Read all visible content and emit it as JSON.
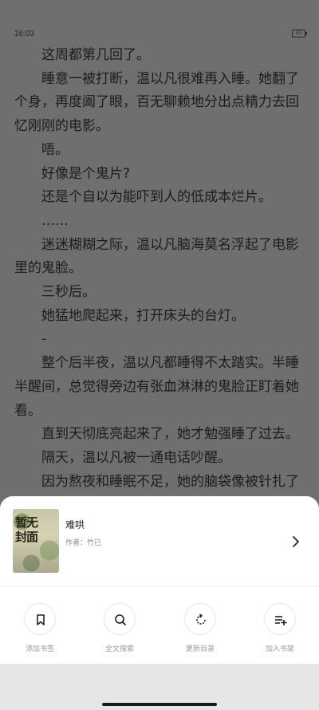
{
  "status_bar": {
    "time": "16:03",
    "battery": "53"
  },
  "reader": {
    "paragraphs": [
      "这周都第几回了。",
      "睡意一被打断，温以凡很难再入睡。她翻了个身，再度阖了眼，百无聊赖地分出点精力去回忆刚刚的电影。",
      "唔。",
      "好像是个鬼片?",
      "还是个自以为能吓到人的低成本烂片。",
      "……",
      "迷迷糊糊之际，温以凡脑海莫名浮起了电影里的鬼脸。",
      "三秒后。",
      "她猛地爬起来，打开床头的台灯。",
      "-",
      "整个后半夜，温以凡都睡得不太踏实。半睡半醒间，总觉得旁边有张血淋淋的鬼脸正盯着她看。",
      "直到天彻底亮起来了，她才勉强睡了过去。",
      "隔天，温以凡被一通电话吵醒。",
      "因为熬夜和睡眠不足，她的脑袋像被针扎了"
    ]
  },
  "book": {
    "cover_text": "暂无封面",
    "title": "难哄",
    "author": "作者：竹已"
  },
  "actions": [
    {
      "label": "添加书签",
      "icon": "bookmark-icon"
    },
    {
      "label": "全文搜索",
      "icon": "search-icon"
    },
    {
      "label": "更新目录",
      "icon": "refresh-icon"
    },
    {
      "label": "加入书架",
      "icon": "add-to-shelf-icon"
    }
  ]
}
